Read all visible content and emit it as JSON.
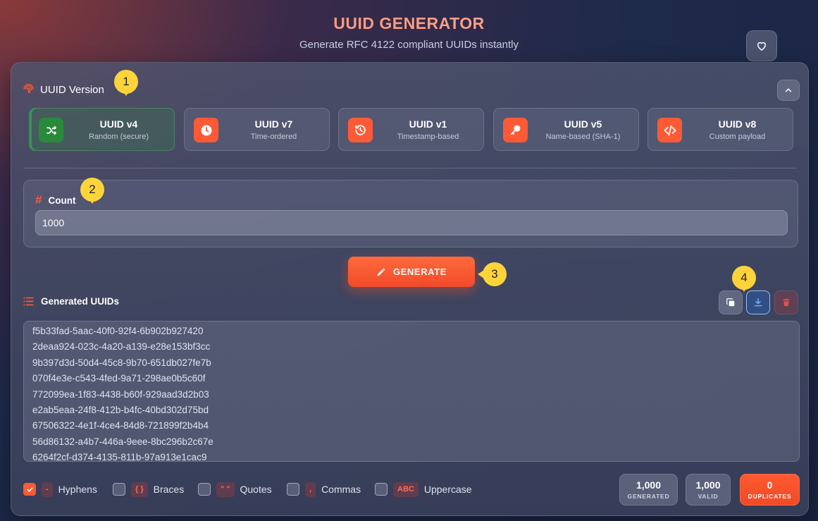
{
  "header": {
    "title": "UUID GENERATOR",
    "subtitle": "Generate RFC 4122 compliant UUIDs instantly"
  },
  "favorite": {
    "icon": "heart-icon"
  },
  "version_section": {
    "title": "UUID Version",
    "icon": "fingerprint-icon",
    "collapse_icon": "chevron-up-icon",
    "versions": [
      {
        "name": "UUID v4",
        "desc": "Random (secure)",
        "icon": "shuffle-icon",
        "active": true
      },
      {
        "name": "UUID v7",
        "desc": "Time-ordered",
        "icon": "clock-icon",
        "active": false
      },
      {
        "name": "UUID v1",
        "desc": "Timestamp-based",
        "icon": "history-icon",
        "active": false
      },
      {
        "name": "UUID v5",
        "desc": "Name-based (SHA-1)",
        "icon": "key-icon",
        "active": false
      },
      {
        "name": "UUID v8",
        "desc": "Custom payload",
        "icon": "code-icon",
        "active": false
      }
    ]
  },
  "count": {
    "label": "Count",
    "icon": "hash-icon",
    "value": "1000"
  },
  "generate": {
    "label": "GENERATE",
    "icon": "pencil-icon"
  },
  "output": {
    "title": "Generated UUIDs",
    "icon": "list-icon",
    "uuids": [
      "f5b33fad-5aac-40f0-92f4-6b902b927420",
      "2deaa924-023c-4a20-a139-e28e153bf3cc",
      "9b397d3d-50d4-45c8-9b70-651db027fe7b",
      "070f4e3e-c543-4fed-9a71-298ae0b5c60f",
      "772099ea-1f83-4438-b60f-929aad3d2b03",
      "e2ab5eaa-24f8-412b-b4fc-40bd302d75bd",
      "67506322-4e1f-4ce4-84d8-721899f2b4b4",
      "56d86132-a4b7-446a-9eee-8bc296b2c67e",
      "6264f2cf-d374-4135-811b-97a913e1cac9"
    ],
    "tools": [
      {
        "name": "copy",
        "icon": "copy-icon"
      },
      {
        "name": "download",
        "icon": "download-icon"
      },
      {
        "name": "delete",
        "icon": "trash-icon"
      }
    ]
  },
  "options": [
    {
      "tag": "-",
      "label": "Hyphens",
      "checked": true
    },
    {
      "tag": "{ }",
      "label": "Braces",
      "checked": false
    },
    {
      "tag": "\" \"",
      "label": "Quotes",
      "checked": false
    },
    {
      "tag": ",",
      "label": "Commas",
      "checked": false
    },
    {
      "tag": "ABC",
      "label": "Uppercase",
      "checked": false
    }
  ],
  "stats": [
    {
      "value": "1,000",
      "label": "GENERATED"
    },
    {
      "value": "1,000",
      "label": "VALID"
    },
    {
      "value": "0",
      "label": "DUPLICATES"
    }
  ],
  "markers": [
    "1",
    "2",
    "3",
    "4"
  ],
  "colors": {
    "accent": "#ff5a36",
    "active_green": "#2a8a3c",
    "marker": "#ffd43b"
  }
}
